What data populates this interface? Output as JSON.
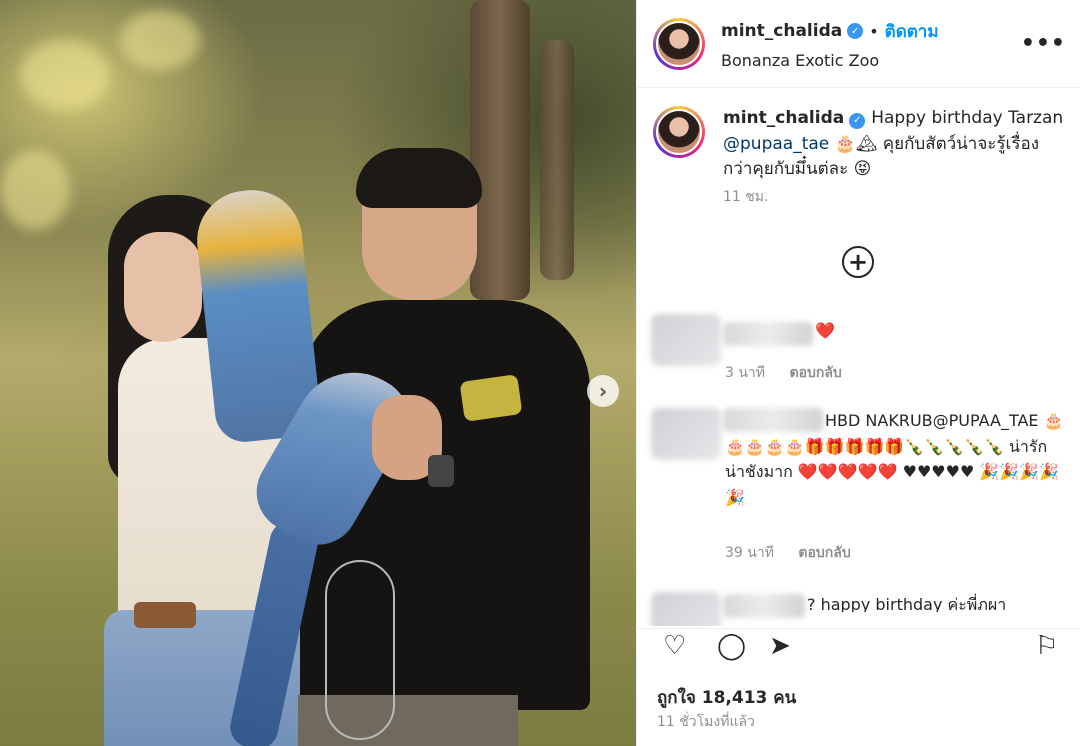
{
  "post": {
    "username": "mint_chalida",
    "follow_label": "ติดตาม",
    "separator": "•",
    "location": "Bonanza Exotic Zoo",
    "verified_glyph": "✓",
    "more_glyph": "•••"
  },
  "caption": {
    "username": "mint_chalida",
    "text_part1": "Happy birthday Tarzan ",
    "mention": "@pupaa_tae",
    "text_part2": " 🎂🏔 คุยกับสัตว์น่าจะรู้เรื่องกว่าคุยกับมึ๋นต่ละ 😝",
    "time": "11 ชม."
  },
  "load_more_glyph": "+",
  "next_glyph": "›",
  "comments": [
    {
      "text": "❤️",
      "time": "3 นาที",
      "reply_label": "ตอบกลับ"
    },
    {
      "text": "HBD NAKRUB@PUPAA_TAE 🎂🎂🎂🎂🎂🎁🎁🎁🎁🎁🍾🍾🍾🍾🍾 น่ารักน่าชังมาก ❤️❤️❤️❤️❤️ ♥♥♥♥♥ 🎉🎉🎉🎉🎉",
      "time": "39 นาที",
      "reply_label": "ตอบกลับ"
    },
    {
      "text": "? happy birthday ค่ะพี่ภผา",
      "time": "",
      "reply_label": ""
    }
  ],
  "actions": {
    "like_icon": "♡",
    "comment_icon": "◯",
    "share_icon": "➤",
    "save_icon": "⚐"
  },
  "likes_text": "ถูกใจ 18,413 คน",
  "posted_time": "11 ชั่วโมงที่แล้ว",
  "colors": {
    "accent": "#0095f6",
    "verified": "#3897f0",
    "mention": "#00376b",
    "muted": "#8e8e8e"
  }
}
